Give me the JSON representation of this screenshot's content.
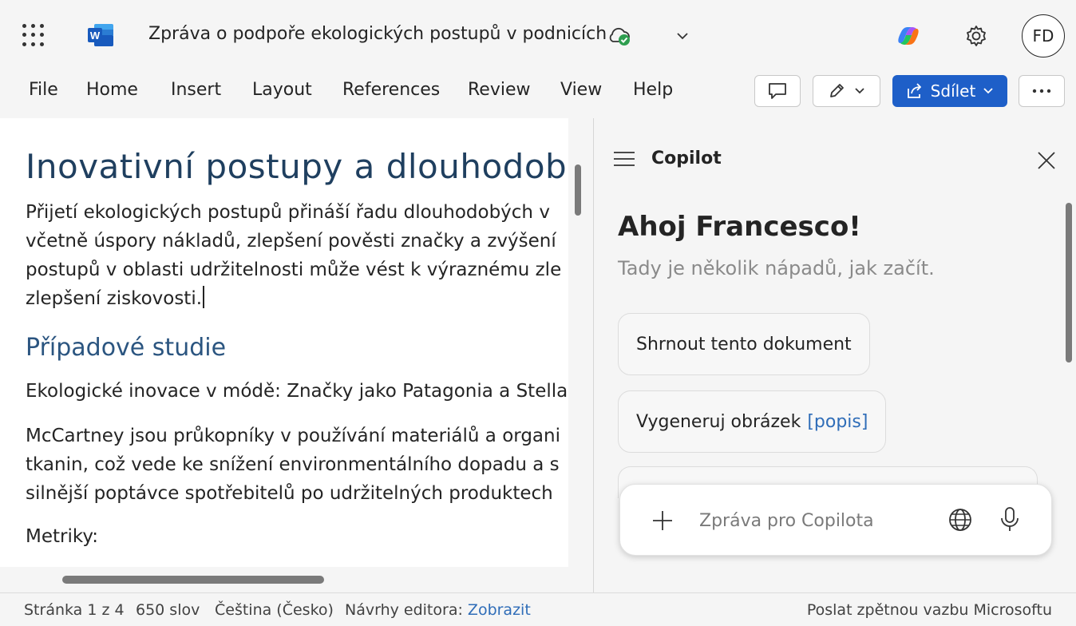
{
  "app": {
    "document_title": "Zpráva o podpoře ekologických postupů v podnicích",
    "avatar_initials": "FD",
    "logo_letter": "W",
    "icons": {
      "app_launcher": "waffle-icon",
      "app_logo": "word-logo",
      "save_status": "cloud-saved-icon",
      "title_menu": "chevron-down-icon",
      "copilot": "copilot-logo",
      "settings": "gear-icon"
    }
  },
  "ribbon": {
    "tabs": [
      "File",
      "Home",
      "Insert",
      "Layout",
      "References",
      "Review",
      "View",
      "Help"
    ],
    "share_label": "Sdílet",
    "icons": {
      "comment": "comment-icon",
      "editing": "pencil-icon",
      "share": "share-icon",
      "more": "more-icon"
    }
  },
  "document": {
    "heading": "Inovativní postupy a dlouhodobé a",
    "paragraph1": [
      "Přijetí ekologických postupů přináší řadu dlouhodobých v",
      "včetně úspory nákladů, zlepšení pověsti značky a zvýšení",
      "postupů v oblasti udržitelnosti může vést k výraznému zle",
      "zlepšení ziskovosti."
    ],
    "subheading": "Případové studie",
    "paragraph2": "Ekologické inovace v módě: Značky jako Patagonia a Stella",
    "paragraph3": [
      "McCartney jsou průkopníky v používání materiálů a organi",
      "tkanin, což vede ke snížení environmentálního dopadu a s",
      "silnější poptávce spotřebitelů po udržitelných produktech"
    ],
    "paragraph4": "Metriky:"
  },
  "copilot": {
    "title": "Copilot",
    "greeting": "Ahoj Francesco!",
    "subtitle": "Tady je několik nápadů, jak začít.",
    "suggestions": [
      {
        "text": "Shrnout tento dokument",
        "link": ""
      },
      {
        "text": "Vygeneruj obrázek",
        "link": "[popis]"
      }
    ],
    "input_placeholder": "Zpráva pro Copilota",
    "icons": {
      "menu": "hamburger-icon",
      "close": "close-icon",
      "attach": "plus-icon",
      "web": "globe-icon",
      "voice": "microphone-icon"
    }
  },
  "statusbar": {
    "page": "Stránka 1 z 4",
    "words": "650 slov",
    "language": "Čeština (Česko)",
    "editor_label": "Návrhy editora:",
    "editor_link": "Zobrazit",
    "feedback": "Poslat zpětnou vazbu Microsoftu"
  },
  "colors": {
    "accent": "#1e5fc8",
    "heading": "#1f3f5f",
    "subheading": "#2b5580",
    "link": "#2f6db8",
    "word_brand": "#185abd"
  }
}
